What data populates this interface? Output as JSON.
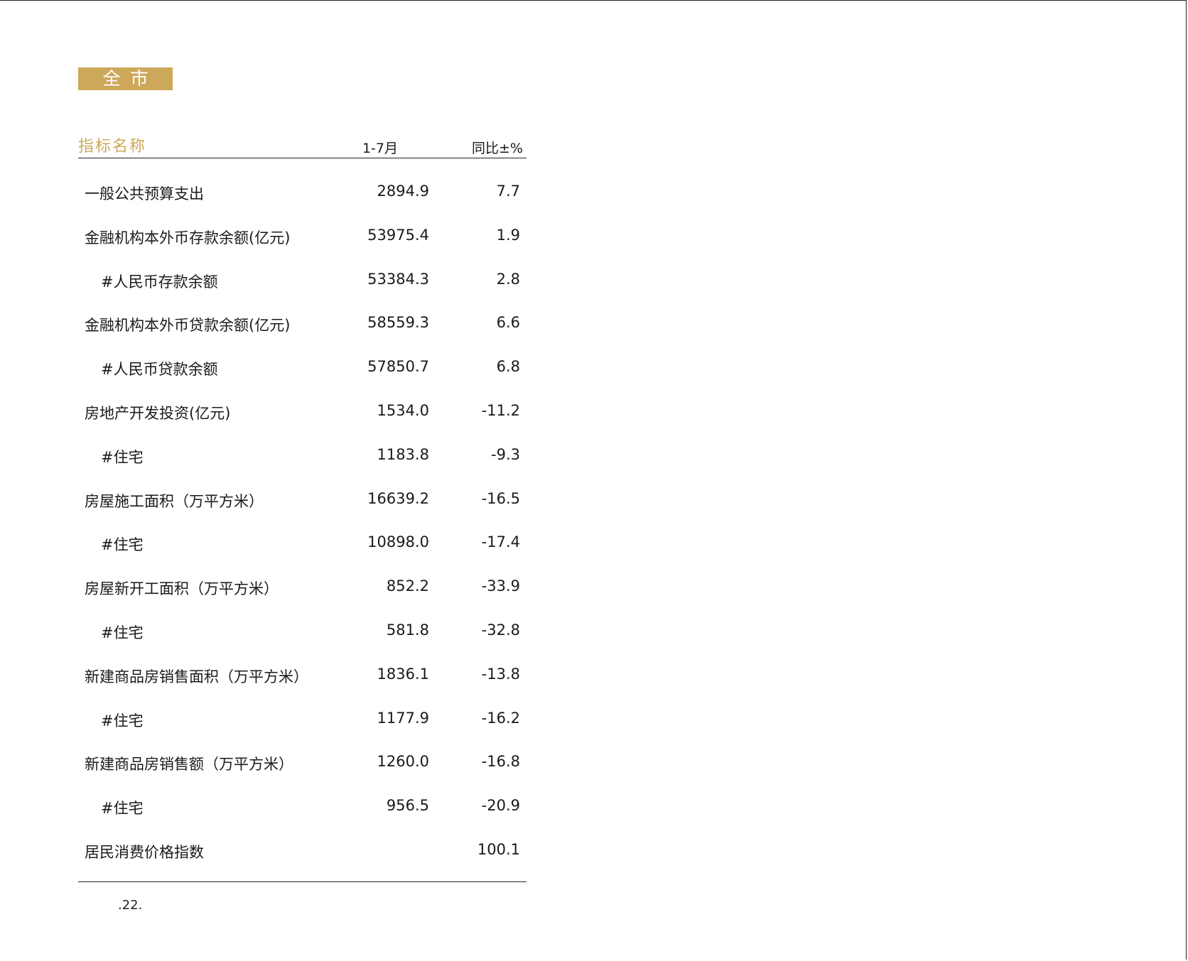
{
  "region_badge": "全市",
  "table": {
    "headers": {
      "name": "指标名称",
      "period": "1-7月",
      "yoy": "同比±%"
    },
    "rows": [
      {
        "name": "一般公共预算支出",
        "value": "2894.9",
        "yoy": "7.7",
        "indent": false
      },
      {
        "name": "金融机构本外币存款余额(亿元)",
        "value": "53975.4",
        "yoy": "1.9",
        "indent": false
      },
      {
        "name": "#人民币存款余额",
        "value": "53384.3",
        "yoy": "2.8",
        "indent": true
      },
      {
        "name": "金融机构本外币贷款余额(亿元)",
        "value": "58559.3",
        "yoy": "6.6",
        "indent": false
      },
      {
        "name": "#人民币贷款余额",
        "value": "57850.7",
        "yoy": "6.8",
        "indent": true
      },
      {
        "name": "房地产开发投资(亿元)",
        "value": "1534.0",
        "yoy": "-11.2",
        "indent": false
      },
      {
        "name": "#住宅",
        "value": "1183.8",
        "yoy": "-9.3",
        "indent": true
      },
      {
        "name": "房屋施工面积（万平方米）",
        "value": "16639.2",
        "yoy": "-16.5",
        "indent": false
      },
      {
        "name": "#住宅",
        "value": "10898.0",
        "yoy": "-17.4",
        "indent": true
      },
      {
        "name": "房屋新开工面积（万平方米）",
        "value": "852.2",
        "yoy": "-33.9",
        "indent": false
      },
      {
        "name": "#住宅",
        "value": "581.8",
        "yoy": "-32.8",
        "indent": true
      },
      {
        "name": "新建商品房销售面积（万平方米）",
        "value": "1836.1",
        "yoy": "-13.8",
        "indent": false
      },
      {
        "name": "#住宅",
        "value": "1177.9",
        "yoy": "-16.2",
        "indent": true
      },
      {
        "name": "新建商品房销售额（万平方米）",
        "value": "1260.0",
        "yoy": "-16.8",
        "indent": false
      },
      {
        "name": "#住宅",
        "value": "956.5",
        "yoy": "-20.9",
        "indent": true
      },
      {
        "name": "居民消费价格指数",
        "value": "",
        "yoy": "100.1",
        "indent": false
      }
    ]
  },
  "page_number": ".22."
}
